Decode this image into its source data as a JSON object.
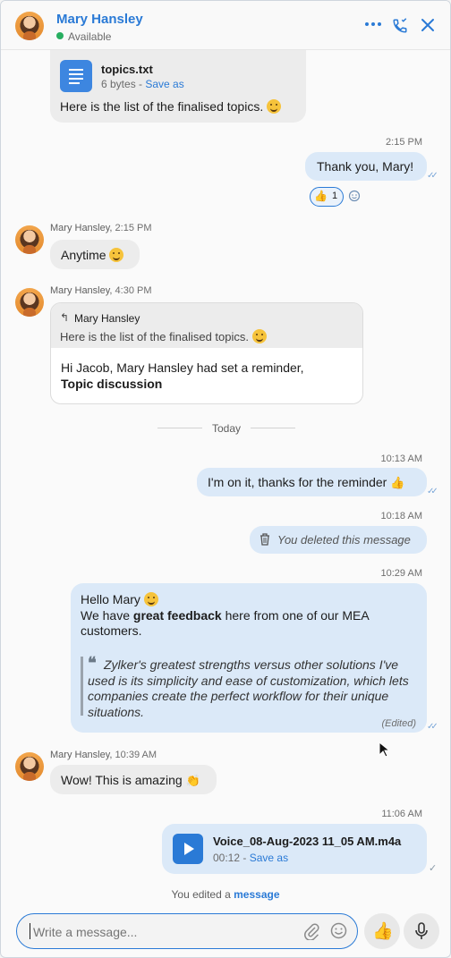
{
  "header": {
    "name": "Mary Hansley",
    "status": "Available",
    "more_icon": "more-dots-icon",
    "call_icon": "phone-icon",
    "close_icon": "close-icon"
  },
  "messages": {
    "file1": {
      "name": "topics.txt",
      "size": "6 bytes",
      "sep": " - ",
      "save": "Save as",
      "caption": "Here is the list of the finalised topics."
    },
    "m_thanks": {
      "time": "2:15 PM",
      "text": "Thank you, Mary!",
      "reaction_count": "1"
    },
    "m_anytime": {
      "sender": "Mary Hansley,",
      "time": "2:15 PM",
      "text": "Anytime"
    },
    "m_reminder": {
      "sender": "Mary Hansley,",
      "time": "4:30 PM",
      "reply_name": "Mary Hansley",
      "reply_text": "Here is the list of the finalised topics.",
      "text": "Hi Jacob, Mary Hansley had set a reminder,",
      "bold": "Topic discussion"
    },
    "day_divider": "Today",
    "m_onit": {
      "time": "10:13 AM",
      "text": "I'm on it, thanks for the reminder"
    },
    "m_deleted": {
      "time": "10:18 AM",
      "text": "You deleted this message"
    },
    "m_feedback": {
      "time": "10:29 AM",
      "line1": "Hello Mary",
      "line2a": "We have ",
      "line2b": "great feedback",
      "line2c": " here from one of our MEA",
      "line3": "customers.",
      "quote": "Zylker's greatest strengths versus other solutions I've used is its simplicity and ease of customization, which lets companies create the perfect workflow for their unique situations.",
      "edited": "(Edited)"
    },
    "m_wow": {
      "sender": "Mary Hansley,",
      "time": "10:39 AM",
      "text": "Wow! This is amazing"
    },
    "m_voice": {
      "time": "11:06 AM",
      "name": "Voice_08-Aug-2023 11_05 AM.m4a",
      "duration": "00:12",
      "sep": " - ",
      "save": "Save as"
    },
    "edited_note": {
      "prefix": "You edited a ",
      "link": "message"
    }
  },
  "composer": {
    "placeholder": "Write a message..."
  },
  "colors": {
    "accent": "#2a7ad6",
    "outgoing": "#dbe9f8",
    "incoming": "#ececec"
  }
}
